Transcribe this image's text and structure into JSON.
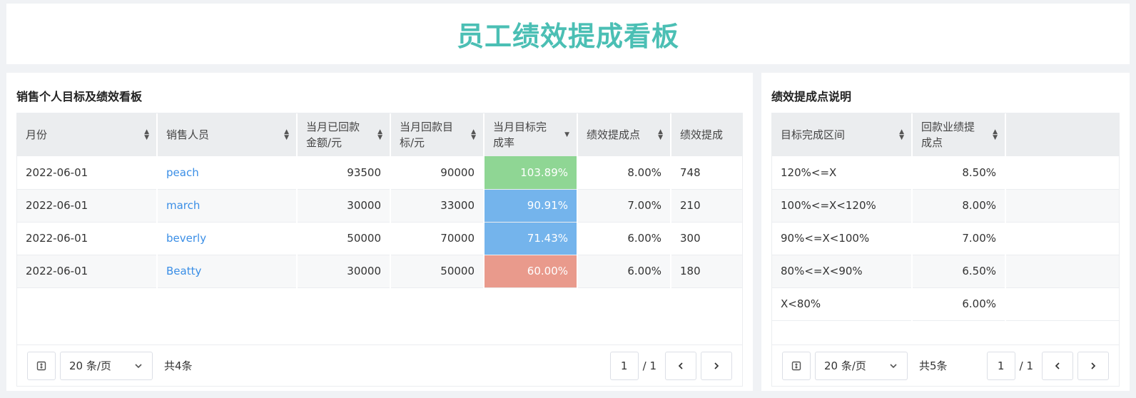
{
  "title": "员工绩效提成看板",
  "left": {
    "title": "销售个人目标及绩效看板",
    "columns": [
      "月份",
      "销售人员",
      "当月已回款金额/元",
      "当月回款目标/元",
      "当月目标完成率",
      "绩效提成点",
      "绩效提成"
    ],
    "rows": [
      {
        "month": "2022-06-01",
        "person": "peach",
        "paid": "93500",
        "target": "90000",
        "rate": "103.89%",
        "point": "8.00%",
        "bonus": "748"
      },
      {
        "month": "2022-06-01",
        "person": "march",
        "paid": "30000",
        "target": "33000",
        "rate": "90.91%",
        "point": "7.00%",
        "bonus": "210"
      },
      {
        "month": "2022-06-01",
        "person": "beverly",
        "paid": "50000",
        "target": "70000",
        "rate": "71.43%",
        "point": "6.00%",
        "bonus": "300"
      },
      {
        "month": "2022-06-01",
        "person": "Beatty",
        "paid": "30000",
        "target": "50000",
        "rate": "60.00%",
        "point": "6.00%",
        "bonus": "180"
      }
    ],
    "pager": {
      "size": "20 条/页",
      "total": "共4条",
      "page": "1",
      "pages": "/ 1"
    }
  },
  "right": {
    "title": "绩效提成点说明",
    "columns": [
      "目标完成区间",
      "回款业绩提成点"
    ],
    "rows": [
      {
        "range": "120%<=X",
        "point": "8.50%"
      },
      {
        "range": "100%<=X<120%",
        "point": "8.00%"
      },
      {
        "range": "90%<=X<100%",
        "point": "7.00%"
      },
      {
        "range": "80%<=X<90%",
        "point": "6.50%"
      },
      {
        "range": "X<80%",
        "point": "6.00%"
      }
    ],
    "pager": {
      "size": "20 条/页",
      "total": "共5条",
      "page": "1",
      "pages": "/ 1"
    }
  },
  "colors": {
    "title": "#4bbfb4",
    "rate_high": "#8fd694",
    "rate_mid": "#74b4ec",
    "rate_low": "#e99a8c",
    "link": "#3a8ee6"
  },
  "icons": {
    "sort": "sort-caret-icon",
    "sort_desc": "sort-desc-icon",
    "expand": "expand-icon",
    "dropdown": "chevron-down-icon",
    "prev": "chevron-left-icon",
    "next": "chevron-right-icon"
  }
}
